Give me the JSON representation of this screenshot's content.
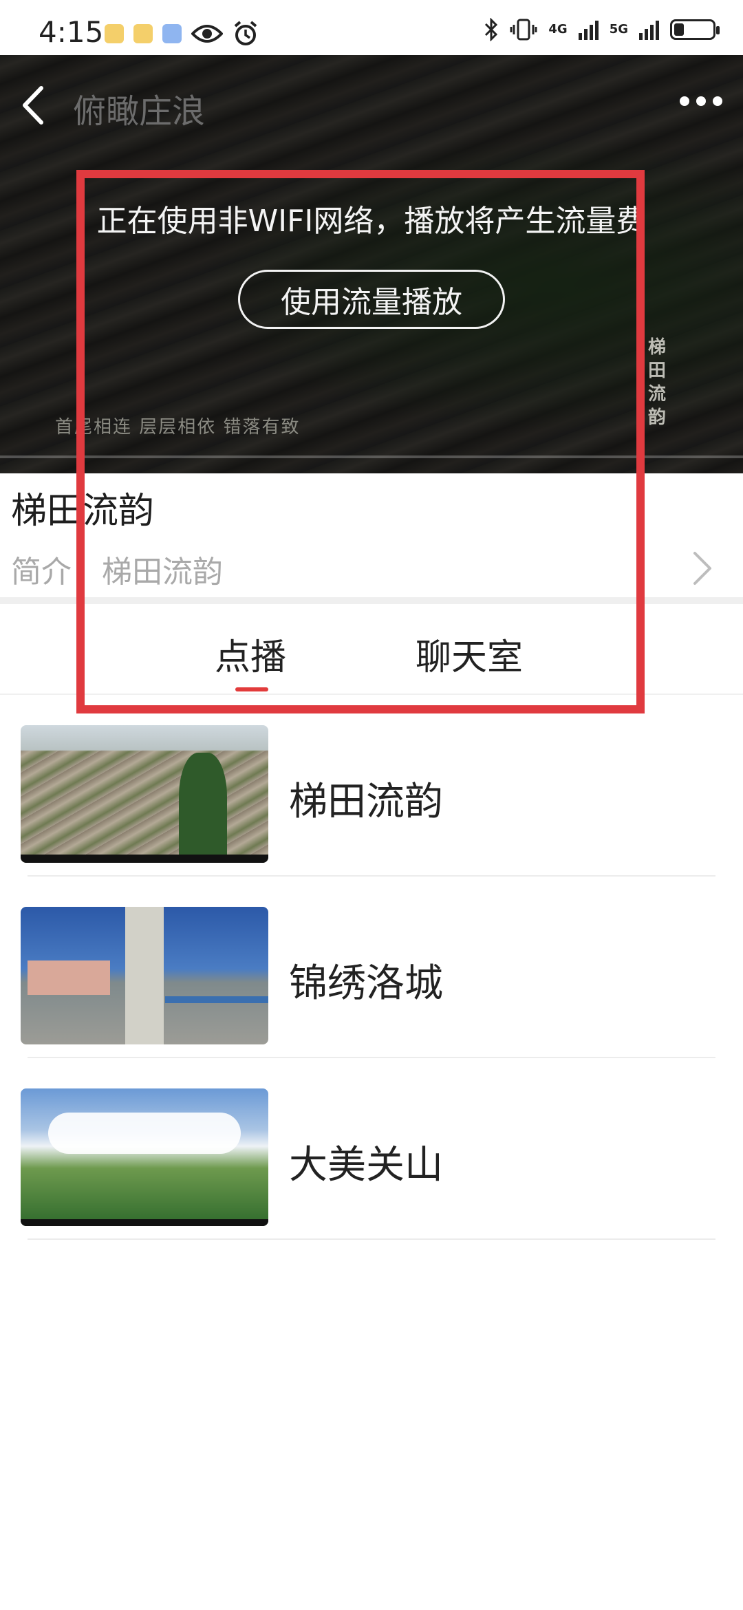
{
  "status_bar": {
    "time": "4:15",
    "net_4g": "4G",
    "net_5g": "5G",
    "left_icons": [
      "notification-icon",
      "notification-icon",
      "notification-icon",
      "eye-icon",
      "alarm-icon"
    ],
    "right_icons": [
      "bluetooth-icon",
      "vibrate-icon",
      "signal-icon",
      "signal-icon",
      "battery-icon"
    ]
  },
  "player": {
    "title": "俯瞰庄浪",
    "warning": "正在使用非WIFI网络，播放将产生流量费",
    "data_play_label": "使用流量播放",
    "caption": "首尾相连 层层相依 错落有致",
    "vertical_caption": "梯田流韵"
  },
  "show": {
    "title": "梯田流韵",
    "intro_label": "简介：",
    "intro_value": "梯田流韵"
  },
  "tabs": [
    {
      "label": "点播",
      "active": true
    },
    {
      "label": "聊天室",
      "active": false
    }
  ],
  "videos": [
    {
      "title": "梯田流韵"
    },
    {
      "title": "锦绣洛城"
    },
    {
      "title": "大美关山"
    }
  ],
  "colors": {
    "accent": "#e23b3b",
    "annotation": "#e03a3f"
  }
}
